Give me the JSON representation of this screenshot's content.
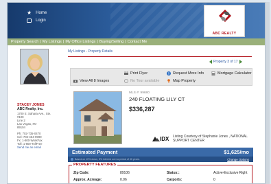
{
  "header": {
    "nav": [
      {
        "label": "Home",
        "icon": "star-icon"
      },
      {
        "label": "Login",
        "icon": "login-icon"
      }
    ],
    "logo_text": "ABC REALTY"
  },
  "menubar": {
    "items": [
      "Property Search",
      "My Listings",
      "My Office Listings",
      "Buying/Selling",
      "Contact Me"
    ]
  },
  "agent": {
    "name": "STACEY JONES",
    "company": "ABC Realty, Inc.",
    "address_lines": [
      "1700 E. Sahara Ave., Ste.",
      "#100",
      "Line 2",
      "Las Vegas, NV",
      "89104"
    ],
    "phones": [
      "Ph: 702-735-0470",
      "Cel: 702-454-9999",
      "Fx: 1-800-WorkFax",
      "Toll: 1-800-TollFree"
    ],
    "email_label": "Send me an email"
  },
  "breadcrumb": {
    "first": "My Listings",
    "separator": "-",
    "current": "Property Details"
  },
  "pager": {
    "text": "Property 3 of 17"
  },
  "toolbar": {
    "print": "Print Flyer",
    "request": "Request More Info",
    "mortgage": "Mortgage Calculator",
    "view_all": "View All 8 Images",
    "tour": "No Tour available",
    "map": "Map Property"
  },
  "listing": {
    "mls_label": "MLS #:",
    "mls_number": "99680",
    "address": "240 FLOATING LILY CT",
    "price": "$336,287",
    "idx_text": "IDX",
    "courtesy": "Listing Courtesy of Stephanie Jones , NATIONAL SUPPORT CENTER"
  },
  "payment": {
    "label": "Estimated Payment",
    "amount": "$1,625/mo",
    "note": "Based on 10% down, 5% interest over a period of 30 years.",
    "change": "Change Options"
  },
  "features": {
    "title": "PROPERTY FEATURES",
    "rows": [
      {
        "k1": "Zip Code:",
        "v1": "89106",
        "k2": "Status::",
        "v2": "Active-Exclusive Right"
      },
      {
        "k1": "Approx. Acreage:",
        "v1": "0.06",
        "k2": "Carports:",
        "v2": "0"
      }
    ]
  },
  "colors": {
    "header_blue": "#2b5c9b",
    "menu_green": "#9ab07a",
    "accent_red": "#b3121a",
    "link_blue": "#2d5aa3",
    "payment_bar": "#3a6aa8"
  }
}
